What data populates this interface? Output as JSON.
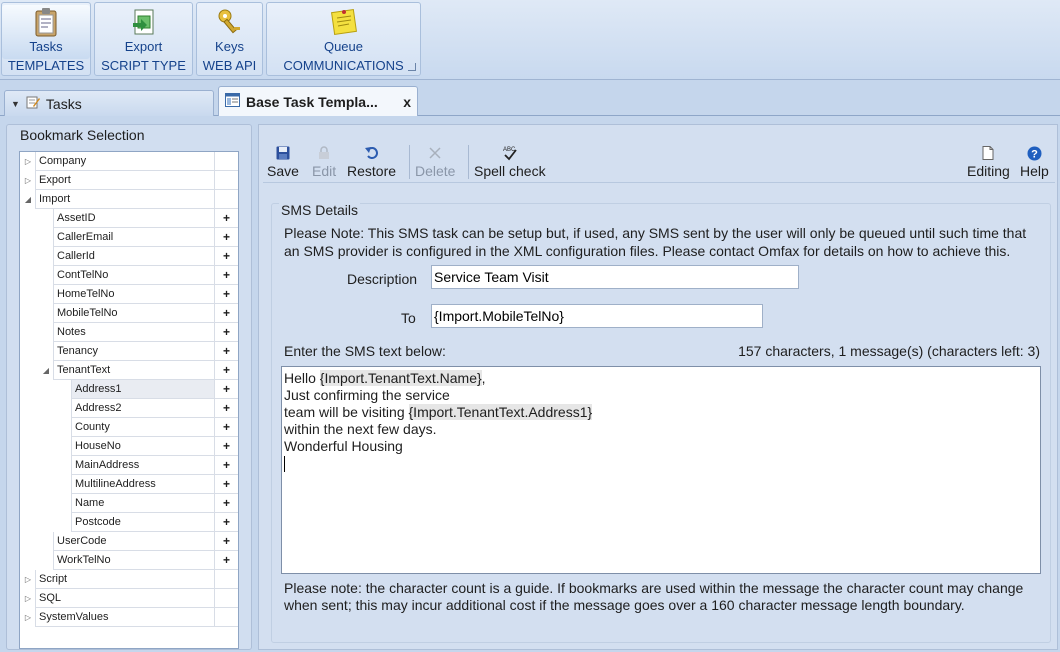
{
  "ribbon": {
    "groups": [
      {
        "button": "Tasks",
        "title": "TEMPLATES",
        "icon": "clipboard-icon"
      },
      {
        "button": "Export",
        "title": "SCRIPT TYPE",
        "icon": "export-icon"
      },
      {
        "button": "Keys",
        "title": "WEB API",
        "icon": "keys-icon"
      },
      {
        "button": "Queue",
        "title": "COMMUNICATIONS",
        "icon": "sticky-note-icon"
      }
    ]
  },
  "tabs": {
    "tasks_label": "Tasks",
    "base_label": "Base Task Templa...",
    "close_glyph": "x"
  },
  "left": {
    "title": "Bookmark Selection",
    "tree": [
      {
        "label": "Company",
        "level": 0,
        "expander": "right",
        "add": false
      },
      {
        "label": "Export",
        "level": 0,
        "expander": "right",
        "add": false
      },
      {
        "label": "Import",
        "level": 0,
        "expander": "down",
        "add": false
      },
      {
        "label": "AssetID",
        "level": 1,
        "expander": "",
        "add": true
      },
      {
        "label": "CallerEmail",
        "level": 1,
        "expander": "",
        "add": true
      },
      {
        "label": "CallerId",
        "level": 1,
        "expander": "",
        "add": true
      },
      {
        "label": "ContTelNo",
        "level": 1,
        "expander": "",
        "add": true
      },
      {
        "label": "HomeTelNo",
        "level": 1,
        "expander": "",
        "add": true
      },
      {
        "label": "MobileTelNo",
        "level": 1,
        "expander": "",
        "add": true
      },
      {
        "label": "Notes",
        "level": 1,
        "expander": "",
        "add": true
      },
      {
        "label": "Tenancy",
        "level": 1,
        "expander": "",
        "add": true
      },
      {
        "label": "TenantText",
        "level": 1,
        "expander": "down",
        "add": true
      },
      {
        "label": "Address1",
        "level": 2,
        "expander": "",
        "add": true,
        "selected": true
      },
      {
        "label": "Address2",
        "level": 2,
        "expander": "",
        "add": true
      },
      {
        "label": "County",
        "level": 2,
        "expander": "",
        "add": true
      },
      {
        "label": "HouseNo",
        "level": 2,
        "expander": "",
        "add": true
      },
      {
        "label": "MainAddress",
        "level": 2,
        "expander": "",
        "add": true
      },
      {
        "label": "MultilineAddress",
        "level": 2,
        "expander": "",
        "add": true
      },
      {
        "label": "Name",
        "level": 2,
        "expander": "",
        "add": true
      },
      {
        "label": "Postcode",
        "level": 2,
        "expander": "",
        "add": true
      },
      {
        "label": "UserCode",
        "level": 1,
        "expander": "",
        "add": true
      },
      {
        "label": "WorkTelNo",
        "level": 1,
        "expander": "",
        "add": true
      },
      {
        "label": "Script",
        "level": 0,
        "expander": "right",
        "add": false
      },
      {
        "label": "SQL",
        "level": 0,
        "expander": "right",
        "add": false
      },
      {
        "label": "SystemValues",
        "level": 0,
        "expander": "right",
        "add": false
      }
    ]
  },
  "toolbar": {
    "save": "Save",
    "edit": "Edit",
    "restore": "Restore",
    "delete": "Delete",
    "spell": "Spell check",
    "editing": "Editing",
    "help": "Help"
  },
  "sms": {
    "title": "SMS Details",
    "note1": "Please Note: This SMS task can be setup but, if used, any SMS sent by the user will only be queued until such time that an SMS provider is configured in the XML configuration files.  Please contact Omfax for details on how to achieve this.",
    "description_label": "Description",
    "description_value": "Service Team Visit",
    "to_label": "To",
    "to_value": "{Import.MobileTelNo}",
    "enter_label": "Enter the SMS text below:",
    "count": "157 characters, 1 message(s) (characters left: 3)",
    "body": {
      "l1a": "Hello ",
      "l1b": "{Import.TenantText.Name}",
      "l1c": ",",
      "l2": "Just confirming the service",
      "l3a": "team will be visiting ",
      "l3b": "{Import.TenantText.Address1}",
      "l4": "within the next few days.",
      "l5": "Wonderful Housing"
    },
    "note2": "Please note: the character count is a guide.  If bookmarks are used within the message the character count may change when sent; this may incur additional cost if the message goes over a 160 character message length boundary."
  }
}
